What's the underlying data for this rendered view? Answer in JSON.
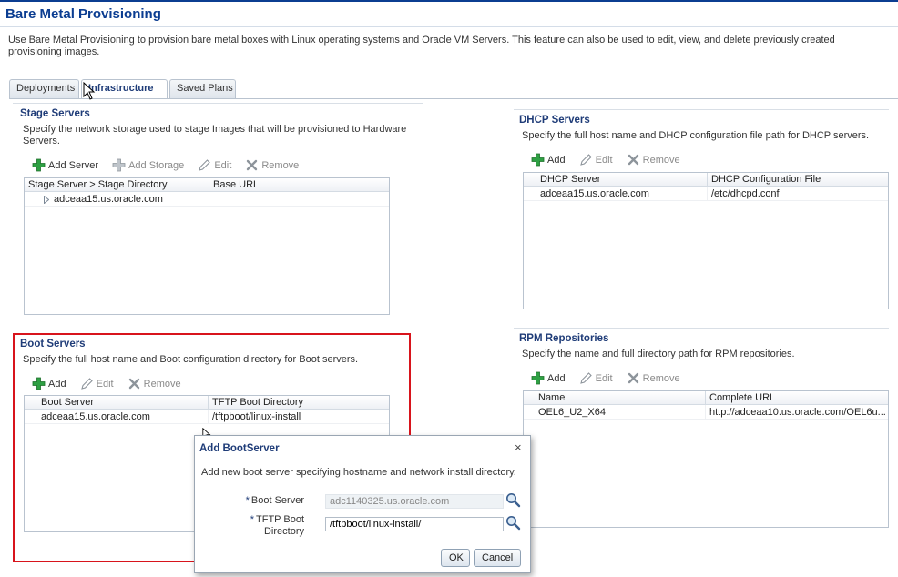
{
  "page": {
    "title": "Bare Metal Provisioning",
    "description": "Use Bare Metal Provisioning to provision bare metal boxes with Linux operating systems and Oracle VM Servers. This feature can also be used to edit, view, and delete previously created provisioning images."
  },
  "tabs": [
    {
      "label": "Deployments",
      "active": false
    },
    {
      "label": "Infrastructure",
      "active": true
    },
    {
      "label": "Saved Plans",
      "active": false
    }
  ],
  "stage": {
    "title": "Stage Servers",
    "description": "Specify the network storage used to stage Images that will be provisioned to Hardware Servers.",
    "toolbar": {
      "add": "Add Server",
      "add_storage": "Add Storage",
      "edit": "Edit",
      "remove": "Remove"
    },
    "columns": [
      "Stage Server > Stage Directory",
      "Base URL"
    ],
    "rows": [
      [
        "adceaa15.us.oracle.com",
        ""
      ]
    ]
  },
  "boot": {
    "title": "Boot Servers",
    "description": "Specify the full host name and Boot configuration directory for Boot servers.",
    "toolbar": {
      "add": "Add",
      "edit": "Edit",
      "remove": "Remove"
    },
    "columns": [
      "Boot Server",
      "TFTP Boot Directory"
    ],
    "rows": [
      [
        "adceaa15.us.oracle.com",
        "/tftpboot/linux-install"
      ]
    ]
  },
  "dhcp": {
    "title": "DHCP Servers",
    "description": "Specify the full host name and DHCP configuration file path for DHCP servers.",
    "toolbar": {
      "add": "Add",
      "edit": "Edit",
      "remove": "Remove"
    },
    "columns": [
      "DHCP Server",
      "DHCP Configuration File"
    ],
    "rows": [
      [
        "adceaa15.us.oracle.com",
        "/etc/dhcpd.conf"
      ]
    ]
  },
  "rpm": {
    "title": "RPM Repositories",
    "description": "Specify the name and full directory path for RPM repositories.",
    "toolbar": {
      "add": "Add",
      "edit": "Edit",
      "remove": "Remove"
    },
    "columns": [
      "Name",
      "Complete URL"
    ],
    "rows": [
      [
        "OEL6_U2_X64",
        "http://adceaa10.us.oracle.com/OEL6u..."
      ]
    ]
  },
  "dialog": {
    "title": "Add BootServer",
    "close": "×",
    "instruction": "Add new boot server specifying hostname and network install directory.",
    "required_mark": "*",
    "boot_server_label": "Boot Server",
    "boot_server_value": "adc1140325.us.oracle.com",
    "tftp_label_line1": "TFTP Boot",
    "tftp_label_line2": "Directory",
    "tftp_value": "/tftpboot/linux-install/",
    "ok": "OK",
    "cancel": "Cancel"
  },
  "colors": {
    "title_blue": "#0b3d91",
    "section_blue": "#1f3c78",
    "highlight_red": "#d8141c",
    "add_green": "#2ea043"
  }
}
